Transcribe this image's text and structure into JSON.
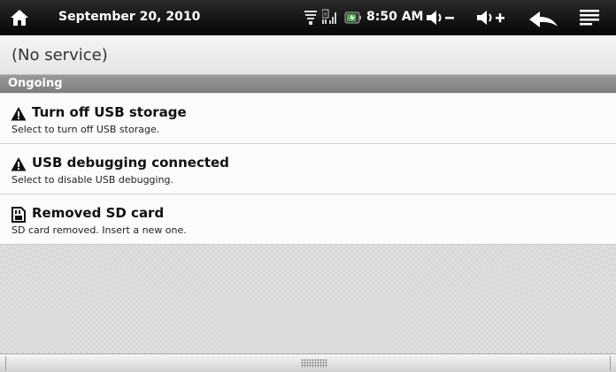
{
  "status_bar": {
    "date": "September 20, 2010",
    "time": "8:50 AM",
    "icons": [
      "home-icon",
      "wifi-icon",
      "sim-signal-icon",
      "battery-icon",
      "volume-down-icon",
      "volume-up-icon",
      "back-icon",
      "menu-icon"
    ]
  },
  "carrier": {
    "text": "(No service)"
  },
  "section": {
    "title": "Ongoing"
  },
  "notifications": [
    {
      "icon": "warning-icon",
      "title": "Turn off USB storage",
      "description": "Select to turn off USB storage."
    },
    {
      "icon": "warning-icon",
      "title": "USB debugging connected",
      "description": "Select to disable USB debugging."
    },
    {
      "icon": "sd-card-icon",
      "title": "Removed SD card",
      "description": "SD card removed. Insert a new one."
    }
  ],
  "colors": {
    "status_bar_bg": "#111111",
    "section_header_bg": "#8a8a8a",
    "notification_bg": "#fbfbfb"
  }
}
